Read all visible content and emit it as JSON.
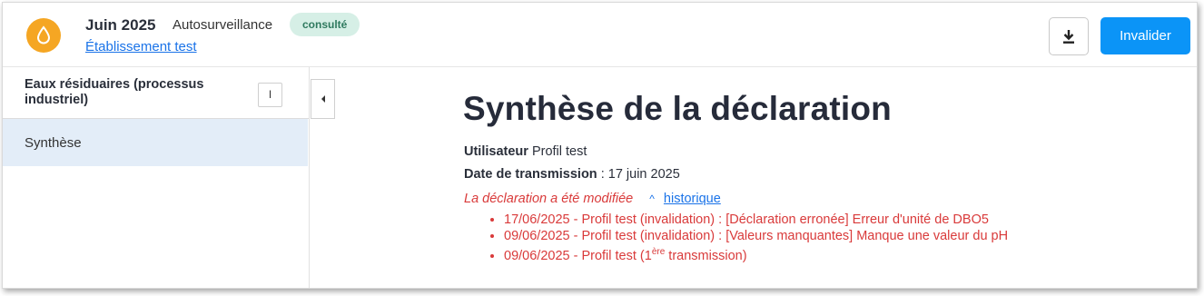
{
  "header": {
    "period": "Juin 2025",
    "type": "Autosurveillance",
    "status_badge": "consulté",
    "establishment_link": "Établissement test",
    "download_icon": "download-icon",
    "invalidate_label": "Invalider"
  },
  "sidebar": {
    "section_title": "Eaux résiduaires (processus industriel)",
    "section_toggle": "I",
    "items": [
      {
        "label": "Synthèse",
        "active": true
      }
    ],
    "collapse_icon": "chevron-left-icon"
  },
  "main": {
    "title": "Synthèse de la déclaration",
    "user_label": "Utilisateur",
    "user_value": "Profil test",
    "date_label": "Date de transmission",
    "date_sep": " : ",
    "date_value": "17 juin 2025",
    "modified_text": "La déclaration a été modifiée",
    "history_link": "historique",
    "history": [
      "17/06/2025 - Profil test (invalidation) : [Déclaration erronée] Erreur d'unité de DBO5",
      "09/06/2025 - Profil test (invalidation) : [Valeurs manquantes] Manque une valeur du pH"
    ],
    "history_first": {
      "prefix": "09/06/2025 - Profil test (1",
      "sup": "ère",
      "suffix": " transmission)"
    }
  },
  "colors": {
    "accent": "#0b94f7",
    "drop_badge": "#f5a623",
    "status_bg": "#d6efe6",
    "status_text": "#2f7a5f",
    "alert": "#d93a3a",
    "link": "#1a73e8",
    "active_item": "#e3edf8"
  }
}
